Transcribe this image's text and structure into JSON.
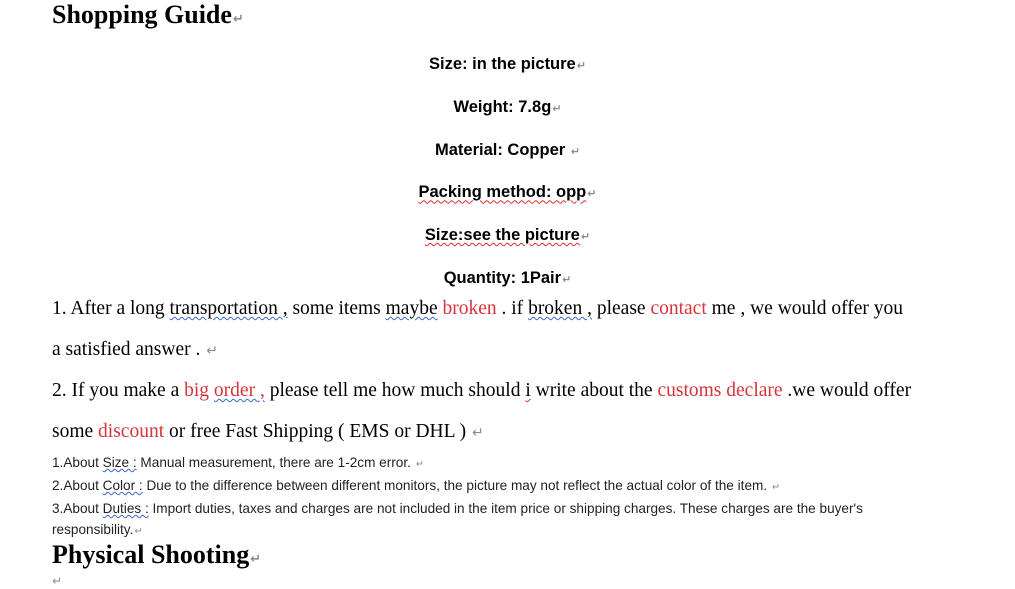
{
  "document": {
    "heading_main": "Shopping Guide",
    "heading_secondary": "Physical Shooting",
    "return_mark": "↵"
  },
  "specs": [
    {
      "label": "Size: in the picture",
      "spellcheck": "none"
    },
    {
      "label": "Weight: 7.8g",
      "spellcheck": "none"
    },
    {
      "label": "Material: Copper ",
      "spellcheck": "none"
    },
    {
      "label": "Packing method: opp",
      "spellcheck": "red-on-opp"
    },
    {
      "label": "Size:see the picture",
      "spellcheck": "red-on-size-see"
    },
    {
      "label": "Quantity: 1Pair",
      "spellcheck": "none"
    }
  ],
  "paragraph_1": {
    "number": "1.",
    "seg_a": " After a long ",
    "seg_transportation": "transportation ,",
    "seg_b": " some items ",
    "seg_maybe": "maybe",
    "seg_c": " ",
    "seg_broken_red": "broken",
    "seg_d": " . if ",
    "seg_broken_black": "broken ,",
    "seg_e": " please ",
    "seg_contact_red": "contact",
    "seg_f": " me , we would offer you",
    "line2": "a satisfied answer .",
    "end_mark": "↵"
  },
  "paragraph_2": {
    "number": "2.",
    "seg_a": " If you make a ",
    "seg_big_red": "big ",
    "seg_order_red": "order ,",
    "seg_b": " please tell me how much should ",
    "seg_i": "i",
    "seg_c": " write about the ",
    "seg_customs_red": "customs declare",
    "seg_d": " .we would offer",
    "line2_a": "some ",
    "line2_discount_red": "discount",
    "line2_b": " or free Fast Shipping ( EMS or DHL ) ",
    "end_mark": "↵"
  },
  "notes": [
    {
      "number": "1.",
      "prefix": "About ",
      "term": "Size :",
      "text": " Manual measurement, there are 1-2cm error.",
      "trailing_space": "    ",
      "end_mark": "↵"
    },
    {
      "number": "2.",
      "prefix": "About ",
      "term": "Color :",
      "text": " Due to the difference between different monitors, the picture may not reflect the actual color of the item. ",
      "trailing_space": " ",
      "end_mark": "↵"
    },
    {
      "number": "3.",
      "prefix": "About ",
      "term": "Duties :",
      "text": " Import duties, taxes and charges are not included in the item price or shipping charges. These charges are the buyer's responsibility.",
      "trailing_space": "",
      "end_mark": "↵"
    }
  ],
  "colors": {
    "accent_red": "#d6333a",
    "spellcheck_red": "#e02b2b",
    "grammarcheck_blue": "#3b68c4",
    "return_mark_gray": "#8c8c8c",
    "body_text": "#000000",
    "notes_text": "#231f20",
    "background": "#ffffff"
  }
}
